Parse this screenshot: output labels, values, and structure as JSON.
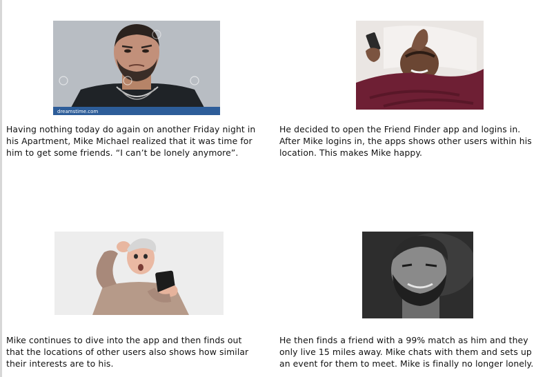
{
  "panels": [
    {
      "image": "man-worried-photo",
      "watermark": "dreamstime.com",
      "caption": "Having nothing today do again on another Friday night in his Apartment, Mike Michael realized that it was time for him to get some friends. “I can’t be lonely anymore”."
    },
    {
      "image": "man-in-bed-with-phone-photo",
      "caption": "He decided to open the Friend Finder app and logins in. After Mike logins in, the apps shows other users within his location. This makes Mike happy."
    },
    {
      "image": "surprised-older-man-with-phone-photo",
      "caption": "Mike continues to dive into the app and then finds out that the locations of other users also shows how similar their interests are to his."
    },
    {
      "image": "bearded-man-smiling-photo",
      "caption": "He then finds a friend with a 99% match as him and they only live 15 miles away. Mike chats with them and sets up an event for them to meet. Mike is finally no longer lonely."
    }
  ]
}
